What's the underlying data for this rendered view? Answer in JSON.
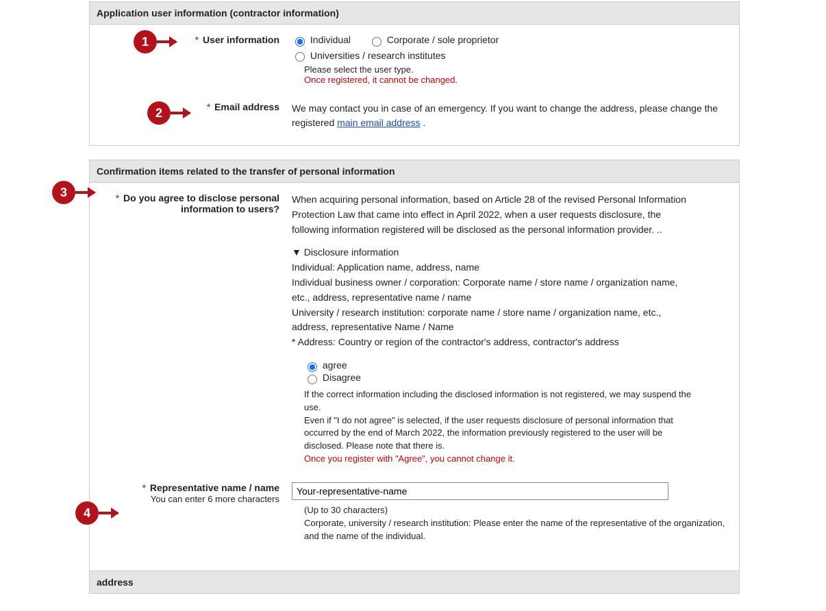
{
  "section1": {
    "header": "Application user information (contractor information)",
    "user_info_label": "User information",
    "radios": {
      "individual": "Individual",
      "corporate": "Corporate / sole proprietor",
      "universities": "Universities / research institutes"
    },
    "select_note": "Please select the user type.",
    "select_warn": "Once registered, it cannot be changed.",
    "email_label": "Email address",
    "email_note_a": "We may contact you in case of an emergency. If you want to change the address, please change the registered ",
    "email_link": "main email address",
    "email_note_b": " ."
  },
  "section2": {
    "header": "Confirmation items related to the transfer of personal information",
    "disclose_label_a": "Do you agree to disclose personal",
    "disclose_label_b": "information to users?",
    "disclose_para": "When acquiring personal information, based on Article 28 of the revised Personal Information Protection Law that came into effect in April 2022, when a user requests disclosure, the following information registered will be disclosed as the personal information provider. ..",
    "dh": "▼ Disclosure information",
    "line_individual": "Individual: Application name, address, name",
    "line_business": "Individual business owner / corporation: Corporate name / store name / organization name, etc., address, representative name / name",
    "line_university": "University / research institution: corporate name / store name / organization name, etc., address, representative Name / Name",
    "line_address": "* Address: Country or region of the contractor's address, contractor's address",
    "agree": "agree",
    "disagree": "Disagree",
    "note_a": "If the correct information including the disclosed information is not registered, we may suspend the use.",
    "note_b": "Even if \"I do not agree\" is selected, if the user requests disclosure of personal information that occurred by the end of March 2022, the information previously registered to the user will be disclosed. Please note that there is.",
    "note_warn": "Once you register with \"Agree\", you cannot change it.",
    "rep_label": "Representative name / name",
    "rep_sub": "You can enter 6 more characters",
    "rep_value": "Your-representative-name",
    "rep_limit": "(Up to 30 characters)",
    "rep_note": "Corporate, university / research institution: Please enter the name of the representative of the organization, and the name of the individual."
  },
  "section3": {
    "header": "address"
  }
}
